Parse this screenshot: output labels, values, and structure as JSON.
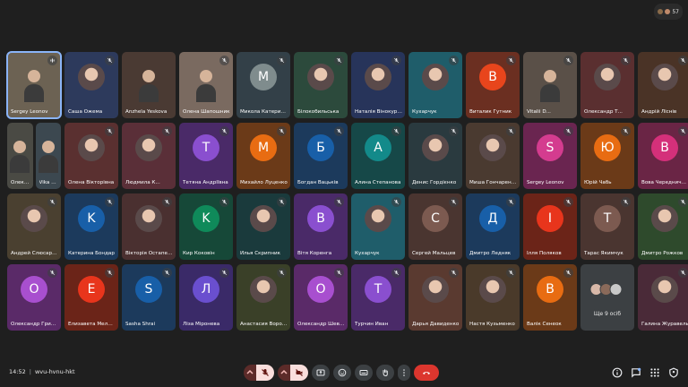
{
  "topbar": {
    "participant_count": "57"
  },
  "meeting": {
    "time": "14:52",
    "separator": "|",
    "code": "wvu-hvnu-hkt"
  },
  "tiles": [
    {
      "name": "Sergey Leonov",
      "kind": "video",
      "bg": "#6c6253",
      "mic": "speaking",
      "active": true
    },
    {
      "name": "Саша Ожема",
      "kind": "photo",
      "bg": "#2d3a5c",
      "mic": "muted"
    },
    {
      "name": "Anzhela Yeskova",
      "kind": "video",
      "bg": "#4a3a33",
      "mic": "none"
    },
    {
      "name": "Олена Шапошник",
      "kind": "video",
      "bg": "#7a6a60",
      "mic": "muted"
    },
    {
      "name": "Микола Катеринчук",
      "kind": "letter",
      "letter": "M",
      "bg": "#334048",
      "avatar": "#7f8c8d",
      "mic": "muted"
    },
    {
      "name": "Білокобильська",
      "kind": "photo",
      "bg": "#2c4a3c",
      "mic": "muted"
    },
    {
      "name": "Наталія Вінокурова",
      "kind": "photo",
      "bg": "#27345a",
      "mic": "muted"
    },
    {
      "name": "Кухарчук",
      "kind": "photo",
      "bg": "#1f5d6a",
      "mic": "muted"
    },
    {
      "name": "Виталик Гутник",
      "kind": "letter",
      "letter": "B",
      "bg": "#6b2f21",
      "avatar": "#e8451c",
      "mic": "muted"
    },
    {
      "name": "Vitalii D...",
      "kind": "video",
      "bg": "#5a5048",
      "mic": "muted"
    },
    {
      "name": "Олександр Т...",
      "kind": "photo",
      "bg": "#5a2f30",
      "mic": "muted"
    },
    {
      "name": "Андрій Ліснів",
      "kind": "photo",
      "bg": "#4a3326",
      "mic": "muted"
    },
    {
      "kind": "split",
      "parts": [
        {
          "name": "Олексі...",
          "bg": "#4a4a44"
        },
        {
          "name": "Vika Ry...",
          "bg": "#3c4850"
        }
      ]
    },
    {
      "name": "Олена Вікторівна",
      "kind": "photo",
      "bg": "#5a3030",
      "mic": "muted"
    },
    {
      "name": "Людмила К...",
      "kind": "photo",
      "bg": "#5a2f38",
      "mic": "muted"
    },
    {
      "name": "Тетяна Андріївна",
      "kind": "letter",
      "letter": "T",
      "bg": "#4a2a68",
      "avatar": "#8a4fcf",
      "mic": "muted"
    },
    {
      "name": "Михайло Луценко",
      "kind": "letter",
      "letter": "M",
      "bg": "#6b3a18",
      "avatar": "#e86c12",
      "mic": "muted"
    },
    {
      "name": "Богдан Вацьків",
      "kind": "letter",
      "letter": "Б",
      "bg": "#1c3a5c",
      "avatar": "#185fa8",
      "mic": "muted"
    },
    {
      "name": "Алина Степанова",
      "kind": "letter",
      "letter": "A",
      "bg": "#164848",
      "avatar": "#138a8a",
      "mic": "muted"
    },
    {
      "name": "Денис Гордієнко",
      "kind": "photo",
      "bg": "#2a3a3f",
      "mic": "muted"
    },
    {
      "name": "Миша Гончаренко",
      "kind": "photo",
      "bg": "#4a3a30",
      "mic": "muted"
    },
    {
      "name": "Sergey Leonov",
      "kind": "letter",
      "letter": "S",
      "bg": "#6a2550",
      "avatar": "#d43c8f",
      "mic": "muted"
    },
    {
      "name": "Юрій Чабь",
      "kind": "letter",
      "letter": "Ю",
      "bg": "#6b3a18",
      "avatar": "#e86c12",
      "mic": "muted"
    },
    {
      "name": "Вова Чередниченко",
      "kind": "letter",
      "letter": "B",
      "bg": "#6a2545",
      "avatar": "#d4307a",
      "mic": "muted"
    },
    {
      "name": "Андрей Слюсаренко",
      "kind": "photo",
      "bg": "#4a4030",
      "mic": "muted"
    },
    {
      "name": "Катерина Бондар",
      "kind": "letter",
      "letter": "K",
      "bg": "#1c3a5c",
      "avatar": "#185fa8",
      "mic": "muted"
    },
    {
      "name": "Вікторія Остапенко",
      "kind": "photo",
      "bg": "#4a3030",
      "mic": "muted"
    },
    {
      "name": "Кир Коковін",
      "kind": "letter",
      "letter": "K",
      "bg": "#164838",
      "avatar": "#0f8a5a",
      "mic": "muted"
    },
    {
      "name": "Илья Скрипник",
      "kind": "photo",
      "bg": "#1a3a3c",
      "mic": "muted"
    },
    {
      "name": "Вітя Коренга",
      "kind": "letter",
      "letter": "B",
      "bg": "#4a2a68",
      "avatar": "#8a4fcf",
      "mic": "muted"
    },
    {
      "name": "Кухарчук",
      "kind": "photo",
      "bg": "#1f5d6a",
      "mic": "muted"
    },
    {
      "name": "Сергей Мальцев",
      "kind": "letter",
      "letter": "C",
      "bg": "#4a3530",
      "avatar": "#7c5a50",
      "mic": "muted"
    },
    {
      "name": "Дмитро Ледняк",
      "kind": "letter",
      "letter": "Д",
      "bg": "#1c3a5c",
      "avatar": "#185fa8",
      "mic": "muted"
    },
    {
      "name": "Ілля Поляков",
      "kind": "letter",
      "letter": "I",
      "bg": "#6b2418",
      "avatar": "#e8351c",
      "mic": "muted"
    },
    {
      "name": "Тарас Якимчук",
      "kind": "letter",
      "letter": "T",
      "bg": "#4a3530",
      "avatar": "#7c5a50",
      "mic": "muted"
    },
    {
      "name": "Дмитро Рожков",
      "kind": "photo",
      "bg": "#2e4a2c",
      "mic": "muted"
    },
    {
      "name": "Олександр Гринько",
      "kind": "letter",
      "letter": "O",
      "bg": "#5a2a68",
      "avatar": "#a84fcf",
      "mic": "muted"
    },
    {
      "name": "Елизавета Мельник",
      "kind": "letter",
      "letter": "E",
      "bg": "#6b2418",
      "avatar": "#e8351c",
      "mic": "muted"
    },
    {
      "name": "Sasha Shrai",
      "kind": "letter",
      "letter": "S",
      "bg": "#1c3a5c",
      "avatar": "#185fa8",
      "mic": "muted"
    },
    {
      "name": "Ліза Міронева",
      "kind": "letter",
      "letter": "Л",
      "bg": "#3a2a68",
      "avatar": "#6a4fcf",
      "mic": "muted"
    },
    {
      "name": "Анастасия Воронова",
      "kind": "photo",
      "bg": "#3a4028",
      "mic": "muted"
    },
    {
      "name": "Олександр Шевченко",
      "kind": "letter",
      "letter": "O",
      "bg": "#5a2a68",
      "avatar": "#a84fcf",
      "mic": "muted"
    },
    {
      "name": "Турчин Иван",
      "kind": "letter",
      "letter": "T",
      "bg": "#4a2a68",
      "avatar": "#8a4fcf",
      "mic": "muted"
    },
    {
      "name": "Дарья Давиденко",
      "kind": "photo",
      "bg": "#5a3a30",
      "mic": "muted"
    },
    {
      "name": "Настя Кузьменко",
      "kind": "photo",
      "bg": "#4a3a2a",
      "mic": "muted"
    },
    {
      "name": "Валік Сенеок",
      "kind": "letter",
      "letter": "B",
      "bg": "#6b3a18",
      "avatar": "#e86c12",
      "mic": "muted"
    },
    {
      "kind": "more",
      "label": "Ще 9 осіб"
    },
    {
      "name": "Галина Журавель",
      "kind": "photo",
      "bg": "#4a2a38",
      "mic": "muted"
    }
  ],
  "controls": {
    "end_call_label": ""
  }
}
